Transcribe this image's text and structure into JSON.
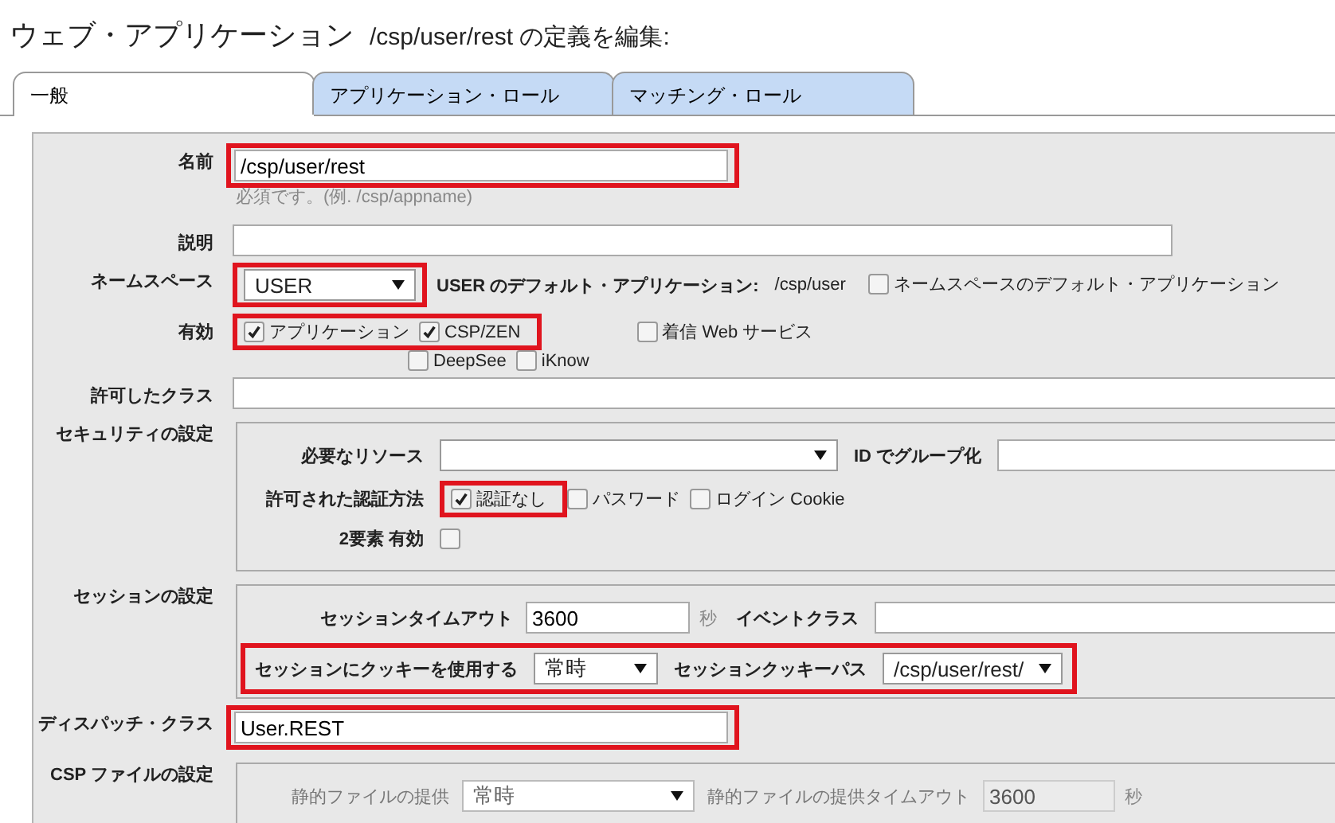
{
  "title": {
    "main": "ウェブ・アプリケーション",
    "sub": "/csp/user/rest の定義を編集:"
  },
  "tabs": [
    {
      "label": "一般",
      "selected": true
    },
    {
      "label": "アプリケーション・ロール",
      "selected": false
    },
    {
      "label": "マッチング・ロール",
      "selected": false
    }
  ],
  "form": {
    "name": {
      "label": "名前",
      "value": "/csp/user/rest",
      "hint": "必須です。(例. /csp/appname)",
      "highlighted": true
    },
    "description": {
      "label": "説明"
    },
    "namespace": {
      "label": "ネームスペース",
      "value": "USER",
      "highlighted": true,
      "default_app_label": "USER のデフォルト・アプリケーション:",
      "default_app_value": "/csp/user",
      "namespace_default": {
        "label": "ネームスペースのデフォルト・アプリケーション",
        "checked": false
      }
    },
    "enabled": {
      "label": "有効",
      "groups": [
        {
          "highlighted": true,
          "options": [
            {
              "label": "アプリケーション",
              "checked": true
            },
            {
              "label": "CSP/ZEN",
              "checked": true
            }
          ]
        },
        {
          "highlighted": false,
          "options": [
            {
              "label": "着信 Web サービス",
              "checked": false
            }
          ]
        }
      ],
      "second_row": [
        {
          "label": "DeepSee",
          "checked": false
        },
        {
          "label": "iKnow",
          "checked": false
        }
      ]
    },
    "allowed_classes": {
      "label": "許可したクラス"
    },
    "security": {
      "label": "セキュリティの設定",
      "resource_label": "必要なリソース",
      "group_by_id_label": "ID でグループ化",
      "auth_label": "許可された認証方法",
      "auth_groups": [
        {
          "highlighted": true,
          "options": [
            {
              "label": "認証なし",
              "checked": true
            }
          ]
        },
        {
          "highlighted": false,
          "options": [
            {
              "label": "パスワード",
              "checked": false
            },
            {
              "label": "ログイン Cookie",
              "checked": false
            }
          ]
        }
      ],
      "two_factor": {
        "label": "2要素 有効",
        "checked": false
      }
    },
    "session": {
      "label": "セッションの設定",
      "timeout_label": "セッションタイムアウト",
      "timeout_value": "3600",
      "timeout_unit": "秒",
      "event_class_label": "イベントクラス",
      "cookie_row": {
        "highlighted": true,
        "use_cookie_label": "セッションにクッキーを使用する",
        "use_cookie_value": "常時",
        "cookie_path_label": "セッションクッキーパス",
        "cookie_path_value": "/csp/user/rest/"
      }
    },
    "dispatch": {
      "label": "ディスパッチ・クラス",
      "value": "User.REST",
      "highlighted": true
    },
    "csp_files": {
      "label": "CSP ファイルの設定",
      "serve_label": "静的ファイルの提供",
      "serve_value": "常時",
      "timeout_label": "静的ファイルの提供タイムアウト",
      "timeout_value": "3600",
      "timeout_unit": "秒",
      "disabled": true
    }
  }
}
